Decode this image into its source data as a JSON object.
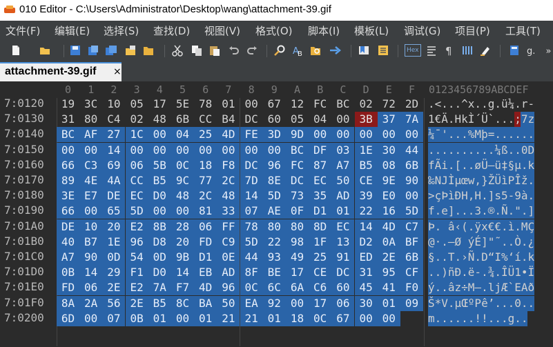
{
  "window": {
    "title": "010 Editor - C:\\Users\\Administrator\\Desktop\\wang\\attachment-39.gif"
  },
  "menu": [
    "文件(F)",
    "编辑(E)",
    "选择(S)",
    "查找(D)",
    "视图(V)",
    "格式(O)",
    "脚本(I)",
    "模板(L)",
    "调试(G)",
    "项目(P)",
    "工具(T)"
  ],
  "toolbar": {
    "icons": [
      "new-file-icon",
      "open-folder-icon",
      "save-icon",
      "save-as-icon",
      "save-all-icon",
      "open-project-icon",
      "folder-icon",
      "cut-icon",
      "copy-icon",
      "paste-icon",
      "undo-icon",
      "redo-icon",
      "find-icon",
      "replace-icon",
      "find-files-icon",
      "goto-icon",
      "bookmark-icon",
      "compare-icon",
      "hex-icon",
      "word-wrap-icon",
      "paragraph-icon",
      "columns-icon",
      "highlight-icon",
      "calculator-icon",
      "units-icon",
      "more-icon"
    ],
    "hex_label": "Hex"
  },
  "tab": {
    "label": "attachment-39.gif",
    "close": "×"
  },
  "editor": {
    "col_headers": [
      "0",
      "1",
      "2",
      "3",
      "4",
      "5",
      "6",
      "7",
      "8",
      "9",
      "A",
      "B",
      "C",
      "D",
      "E",
      "F"
    ],
    "ascii_header": "0123456789ABCDEF",
    "rows": [
      {
        "addr": "7:0120",
        "hex": [
          "19",
          "3C",
          "10",
          "05",
          "17",
          "5E",
          "78",
          "01",
          "00",
          "67",
          "12",
          "FC",
          "BC",
          "02",
          "72",
          "2D"
        ],
        "ascii": ".<...^x..g.ü¼.r-"
      },
      {
        "addr": "7:0130",
        "hex": [
          "31",
          "80",
          "C4",
          "02",
          "48",
          "6B",
          "CC",
          "B4",
          "DC",
          "60",
          "05",
          "04",
          "00",
          "3B",
          "37",
          "7A"
        ],
        "ascii": "1€Ä.HkÌ´Ü`...;7z"
      },
      {
        "addr": "7:0140",
        "hex": [
          "BC",
          "AF",
          "27",
          "1C",
          "00",
          "04",
          "25",
          "4D",
          "FE",
          "3D",
          "9D",
          "00",
          "00",
          "00",
          "00",
          "00"
        ],
        "ascii": "¼¯'...%Mþ=......"
      },
      {
        "addr": "7:0150",
        "hex": [
          "00",
          "00",
          "14",
          "00",
          "00",
          "00",
          "00",
          "00",
          "00",
          "00",
          "BC",
          "DF",
          "03",
          "1E",
          "30",
          "44"
        ],
        "ascii": "..........¼ß..0D"
      },
      {
        "addr": "7:0160",
        "hex": [
          "66",
          "C3",
          "69",
          "06",
          "5B",
          "0C",
          "18",
          "F8",
          "DC",
          "96",
          "FC",
          "87",
          "A7",
          "B5",
          "08",
          "6B"
        ],
        "ascii": "fÃi.[..øÜ–ü‡§µ.k"
      },
      {
        "addr": "7:0170",
        "hex": [
          "89",
          "4E",
          "4A",
          "CC",
          "B5",
          "9C",
          "77",
          "2C",
          "7D",
          "8E",
          "DC",
          "EC",
          "50",
          "CE",
          "9E",
          "90"
        ],
        "ascii": "‰NJÌµœw,}ŽÜìPÎž."
      },
      {
        "addr": "7:0180",
        "hex": [
          "3E",
          "E7",
          "DE",
          "EC",
          "D0",
          "48",
          "2C",
          "48",
          "14",
          "5D",
          "73",
          "35",
          "AD",
          "39",
          "E0",
          "00"
        ],
        "ascii": ">çÞìÐH,H.]s5-9à."
      },
      {
        "addr": "7:0190",
        "hex": [
          "66",
          "00",
          "65",
          "5D",
          "00",
          "00",
          "81",
          "33",
          "07",
          "AE",
          "0F",
          "D1",
          "01",
          "22",
          "16",
          "5D"
        ],
        "ascii": "f.e]...3.®.Ñ.\".]"
      },
      {
        "addr": "7:01A0",
        "hex": [
          "DE",
          "10",
          "20",
          "E2",
          "8B",
          "28",
          "06",
          "FF",
          "78",
          "80",
          "80",
          "8D",
          "EC",
          "14",
          "4D",
          "C7"
        ],
        "ascii": "Þ. â‹(.ÿx€€.ì.MÇ"
      },
      {
        "addr": "7:01B0",
        "hex": [
          "40",
          "B7",
          "1E",
          "96",
          "D8",
          "20",
          "FD",
          "C9",
          "5D",
          "22",
          "98",
          "1F",
          "13",
          "D2",
          "0A",
          "BF"
        ],
        "ascii": "@·.–Ø ýÉ]\"˜..Ò.¿"
      },
      {
        "addr": "7:01C0",
        "hex": [
          "A7",
          "90",
          "0D",
          "54",
          "0D",
          "9B",
          "D1",
          "0E",
          "44",
          "93",
          "49",
          "25",
          "91",
          "ED",
          "2E",
          "6B"
        ],
        "ascii": "§..T.›Ñ.D“I%‘í.k"
      },
      {
        "addr": "7:01D0",
        "hex": [
          "0B",
          "14",
          "29",
          "F1",
          "D0",
          "14",
          "EB",
          "AD",
          "8F",
          "BE",
          "17",
          "CE",
          "DC",
          "31",
          "95",
          "CF"
        ],
        "ascii": "..)ñÐ.ë-.¾.ÎÜ1•Ï"
      },
      {
        "addr": "7:01E0",
        "hex": [
          "FD",
          "06",
          "2E",
          "E2",
          "7A",
          "F7",
          "4D",
          "96",
          "0C",
          "6C",
          "6A",
          "C6",
          "60",
          "45",
          "41",
          "F0"
        ],
        "ascii": "ý..âz÷M–.ljÆ`EAð"
      },
      {
        "addr": "7:01F0",
        "hex": [
          "8A",
          "2A",
          "56",
          "2E",
          "B5",
          "8C",
          "BA",
          "50",
          "EA",
          "92",
          "00",
          "17",
          "06",
          "30",
          "01",
          "09"
        ],
        "ascii": "Š*V.µŒºPê’...0.."
      },
      {
        "addr": "7:0200",
        "hex": [
          "6D",
          "00",
          "07",
          "0B",
          "01",
          "00",
          "01",
          "21",
          "21",
          "01",
          "18",
          "0C",
          "67",
          "00",
          "00"
        ],
        "ascii": "m......!!...g.."
      }
    ]
  },
  "colors": {
    "selection": "#2a64a8",
    "cursor": "#8b1a1a",
    "background": "#2b2b2b"
  }
}
